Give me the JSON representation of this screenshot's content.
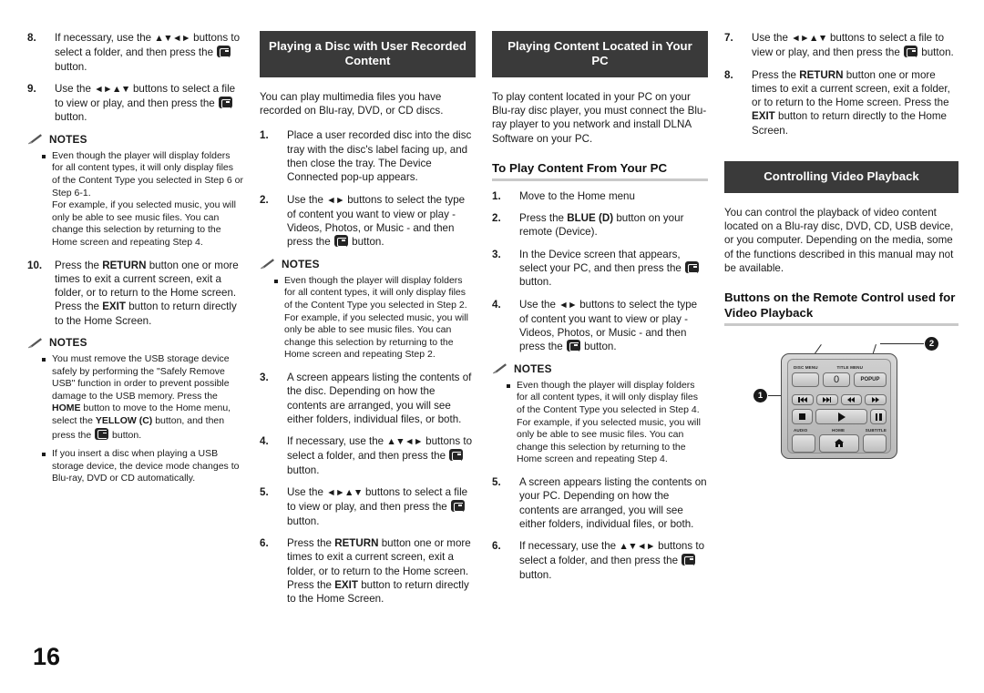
{
  "page": {
    "number": "16"
  },
  "icons": {
    "enter_button": "enter-button-icon",
    "notes": "pencil-notes-icon"
  },
  "colors": {
    "header_bar_bg": "#3a3a3a",
    "header_bar_text": "#ffffff",
    "rule": "#c9c9c9",
    "text": "#1a1a1a"
  },
  "column1": {
    "steps": [
      {
        "num": "8.",
        "html": "If necessary, use the <span class=\"arrows\">▲▼◄►</span> buttons to select a folder, and then press the <span class=\"ebtn\" data-name=\"enter-button-icon\" data-interactable=\"false\"></span> button."
      },
      {
        "num": "9.",
        "html": "Use the <span class=\"arrows\">◄►▲▼</span> buttons to select a file to view or play, and then press the <span class=\"ebtn\" data-name=\"enter-button-icon\" data-interactable=\"false\"></span> button."
      }
    ],
    "notes1": {
      "label": "NOTES",
      "items": [
        "Even though the player will display folders for all content types, it will only display files of the Content Type you selected in Step 6 or Step 6-1.<br>For example, if you selected music, you will only be able to see music files. You can change this selection by returning to the Home screen and repeating Step 4."
      ]
    },
    "steps2": [
      {
        "num": "10.",
        "html": "Press the <b>RETURN</b> button one or more times to exit a current screen, exit a folder, or to return to the Home screen. Press the <b>EXIT</b> button to return directly to the Home Screen."
      }
    ],
    "notes2": {
      "label": "NOTES",
      "items": [
        "You must remove the USB storage device safely by performing the \"Safely Remove USB\" function in order to prevent possible damage to the USB memory. Press the <b>HOME</b> button to move to the Home menu, select the <b>YELLOW</b> <b>(C)</b> button, and then press the <span class=\"ebtn\" data-name=\"enter-button-icon\" data-interactable=\"false\"></span> button.",
        "If you insert a disc when playing a USB storage device, the device mode changes to Blu-ray, DVD or CD automatically."
      ]
    }
  },
  "column2": {
    "header": "Playing a Disc with User Recorded Content",
    "intro": "You can play multimedia files you have recorded on Blu-ray, DVD, or CD discs.",
    "steps": [
      {
        "num": "1.",
        "html": "Place a user recorded disc into the disc tray with the disc's label facing up, and then close the tray. The Device Connected pop-up appears."
      },
      {
        "num": "2.",
        "html": "Use the <span class=\"arrows\">◄►</span> buttons to select the type of content you want to view or play - Videos, Photos, or Music - and then press the <span class=\"ebtn\" data-name=\"enter-button-icon\" data-interactable=\"false\"></span> button."
      }
    ],
    "notes": {
      "label": "NOTES",
      "items": [
        "Even though the player will display folders for all content types, it will only display files of the Content Type you selected in Step 2. For example, if you selected music, you will only be able to see music files. You can change this selection by returning to the Home screen and repeating Step 2."
      ]
    },
    "steps2": [
      {
        "num": "3.",
        "html": "A screen appears listing the contents of the disc. Depending on how the contents are arranged, you will see either folders, individual files, or both."
      },
      {
        "num": "4.",
        "html": "If necessary, use the <span class=\"arrows\">▲▼◄►</span> buttons to select a folder, and then press the <span class=\"ebtn\" data-name=\"enter-button-icon\" data-interactable=\"false\"></span> button."
      },
      {
        "num": "5.",
        "html": "Use the <span class=\"arrows\">◄►▲▼</span> buttons to select a file to view or play, and then press the <span class=\"ebtn\" data-name=\"enter-button-icon\" data-interactable=\"false\"></span> button."
      },
      {
        "num": "6.",
        "html": "Press the <b>RETURN</b> button one or more times to exit a current screen, exit a folder, or to return to the Home screen. Press the <b>EXIT</b> button to return directly to the Home Screen."
      }
    ]
  },
  "column3": {
    "header": "Playing Content Located in Your PC",
    "intro": "To play content located in your PC on your Blu-ray disc player, you must connect the Blu-ray player to you network and install DLNA Software on your PC.",
    "subhead": "To Play Content From Your PC",
    "steps": [
      {
        "num": "1.",
        "html": "Move to the Home menu"
      },
      {
        "num": "2.",
        "html": "Press the <b>BLUE (D)</b> button on your remote (Device)."
      },
      {
        "num": "3.",
        "html": "In the Device screen that appears, select your PC, and then press the <span class=\"ebtn\" data-name=\"enter-button-icon\" data-interactable=\"false\"></span> button."
      },
      {
        "num": "4.",
        "html": "Use the <span class=\"arrows\">◄►</span> buttons to select the type of content you want to view or play - Videos, Photos, or Music - and then press the <span class=\"ebtn\" data-name=\"enter-button-icon\" data-interactable=\"false\"></span> button."
      }
    ],
    "notes": {
      "label": "NOTES",
      "items": [
        "Even though the player will display folders for all content types, it will only display files of the Content Type you selected in Step 4. For example, if you selected music, you will only be able to see music files. You can change this selection by returning to the Home screen and repeating Step 4."
      ]
    },
    "steps2": [
      {
        "num": "5.",
        "html": "A screen appears listing the contents on your PC. Depending on how the contents are arranged, you will see either folders, individual files, or both."
      },
      {
        "num": "6.",
        "html": "If necessary, use the <span class=\"arrows\">▲▼◄►</span> buttons to select a folder, and then press the <span class=\"ebtn\" data-name=\"enter-button-icon\" data-interactable=\"false\"></span> button."
      }
    ]
  },
  "column4": {
    "steps": [
      {
        "num": "7.",
        "html": "Use the <span class=\"arrows\">◄►▲▼</span> buttons to select a file to view or play, and then press the <span class=\"ebtn\" data-name=\"enter-button-icon\" data-interactable=\"false\"></span> button."
      },
      {
        "num": "8.",
        "html": "Press the <b>RETURN</b> button one or more times to exit a current screen, exit a folder, or to return to the Home screen. Press the <b>EXIT</b> button to return directly to the Home Screen."
      }
    ],
    "header": "Controlling Video Playback",
    "intro": "You can control the playback of video content located on a Blu-ray disc, DVD, CD, USB device, or you computer. Depending on the media, some of the functions described in this manual may not be available.",
    "subhead": "Buttons on the Remote Control used for Video Playback",
    "remote": {
      "callouts": [
        "1",
        "2"
      ],
      "keys": {
        "disc_menu_label": "DISC MENU",
        "title_menu_label": "TITLE MENU",
        "zero": "0",
        "popup": "POPUP",
        "audio_label": "AUDIO",
        "home_label": "HOME",
        "subtitle_label": "SUBTITLE"
      }
    }
  }
}
